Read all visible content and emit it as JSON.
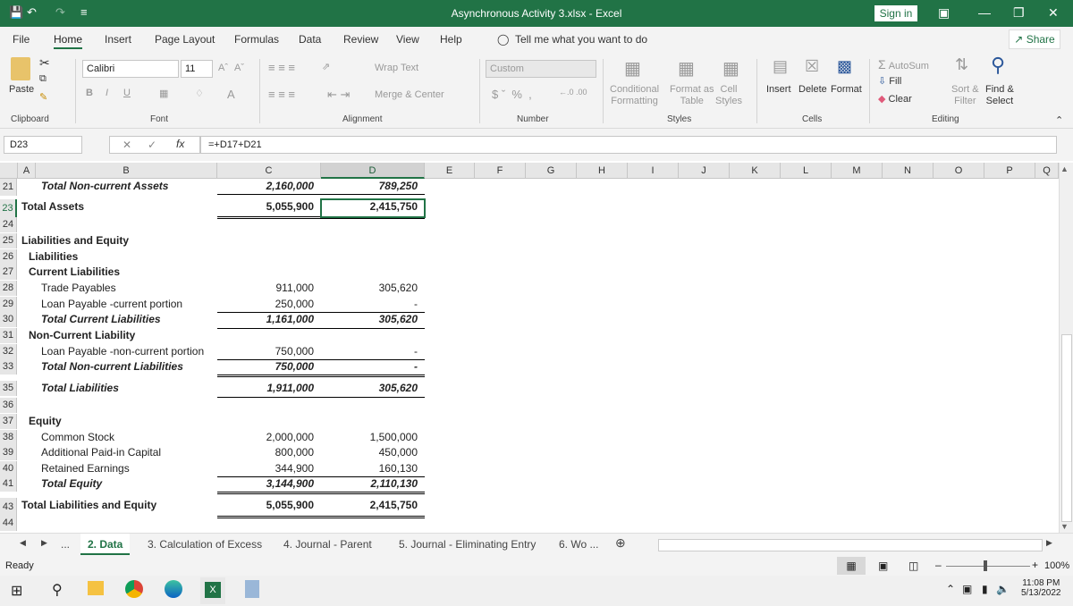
{
  "titlebar": {
    "title": "Asynchronous Activity 3.xlsx  -  Excel",
    "sign_in": "Sign in"
  },
  "menu": {
    "items": [
      "File",
      "Home",
      "Insert",
      "Page Layout",
      "Formulas",
      "Data",
      "Review",
      "View",
      "Help"
    ],
    "tell_me": "Tell me what you want to do",
    "share": "Share"
  },
  "ribbon": {
    "paste": "Paste",
    "font_name": "Calibri",
    "font_size": "11",
    "wrap_text": "Wrap Text",
    "merge_center": "Merge & Center",
    "number_format": "Custom",
    "conditional_formatting": [
      "Conditional",
      "Formatting"
    ],
    "format_as_table": [
      "Format as",
      "Table"
    ],
    "cell_styles": [
      "Cell",
      "Styles"
    ],
    "insert": "Insert",
    "delete": "Delete",
    "format": "Format",
    "autosum": "AutoSum",
    "fill": "Fill",
    "clear": "Clear",
    "sort_filter": [
      "Sort &",
      "Filter"
    ],
    "find_select": [
      "Find &",
      "Select"
    ],
    "groups": [
      "Clipboard",
      "Font",
      "Alignment",
      "Number",
      "Styles",
      "Cells",
      "Editing"
    ]
  },
  "formula_bar": {
    "name_box": "D23",
    "formula": "=+D17+D21"
  },
  "columns": [
    "A",
    "B",
    "C",
    "D",
    "E",
    "F",
    "G",
    "H",
    "I",
    "J",
    "K",
    "L",
    "M",
    "N",
    "O",
    "P",
    "Q"
  ],
  "sheet": {
    "rows": [
      {
        "n": "21",
        "label": "Total Non-current Assets",
        "style": "bi",
        "indent": 2,
        "c": "2,160,000",
        "d": "789,250"
      },
      {
        "n": "23",
        "label": "Total Assets",
        "style": "b",
        "indent": 0,
        "c": "5,055,900",
        "d": "2,415,750"
      },
      {
        "n": "24",
        "label": "",
        "style": "",
        "indent": 0,
        "c": "",
        "d": ""
      },
      {
        "n": "25",
        "label": "Liabilities and Equity",
        "style": "b",
        "indent": 0,
        "c": "",
        "d": ""
      },
      {
        "n": "26",
        "label": "Liabilities",
        "style": "b",
        "indent": 1,
        "c": "",
        "d": ""
      },
      {
        "n": "27",
        "label": "Current Liabilities",
        "style": "b",
        "indent": 1,
        "c": "",
        "d": ""
      },
      {
        "n": "28",
        "label": "Trade Payables",
        "style": "",
        "indent": 2,
        "c": "911,000",
        "d": "305,620"
      },
      {
        "n": "29",
        "label": "Loan Payable -current portion",
        "style": "",
        "indent": 2,
        "c": "250,000",
        "d": "-"
      },
      {
        "n": "30",
        "label": "Total Current Liabilities",
        "style": "bi",
        "indent": 2,
        "c": "1,161,000",
        "d": "305,620"
      },
      {
        "n": "31",
        "label": "Non-Current Liability",
        "style": "b",
        "indent": 1,
        "c": "",
        "d": ""
      },
      {
        "n": "32",
        "label": "Loan Payable -non-current portion",
        "style": "",
        "indent": 2,
        "c": "750,000",
        "d": "-"
      },
      {
        "n": "33",
        "label": "Total Non-current Liabilities",
        "style": "bi",
        "indent": 2,
        "c": "750,000",
        "d": "-"
      },
      {
        "n": "35",
        "label": "Total Liabilities",
        "style": "bi",
        "indent": 2,
        "c": "1,911,000",
        "d": "305,620"
      },
      {
        "n": "36",
        "label": "",
        "style": "",
        "indent": 0,
        "c": "",
        "d": ""
      },
      {
        "n": "37",
        "label": "Equity",
        "style": "b",
        "indent": 1,
        "c": "",
        "d": ""
      },
      {
        "n": "38",
        "label": "Common Stock",
        "style": "",
        "indent": 2,
        "c": "2,000,000",
        "d": "1,500,000"
      },
      {
        "n": "39",
        "label": "Additional Paid-in Capital",
        "style": "",
        "indent": 2,
        "c": "800,000",
        "d": "450,000"
      },
      {
        "n": "40",
        "label": "Retained Earnings",
        "style": "",
        "indent": 2,
        "c": "344,900",
        "d": "160,130"
      },
      {
        "n": "41",
        "label": "Total Equity",
        "style": "bi",
        "indent": 2,
        "c": "3,144,900",
        "d": "2,110,130"
      },
      {
        "n": "43",
        "label": "Total Liabilities and Equity",
        "style": "b",
        "indent": 0,
        "c": "5,055,900",
        "d": "2,415,750"
      },
      {
        "n": "44",
        "label": "",
        "style": "",
        "indent": 0,
        "c": "",
        "d": ""
      }
    ]
  },
  "tabs": {
    "items": [
      "2. Data",
      "3. Calculation of Excess",
      "4. Journal - Parent",
      "5. Journal - Eliminating Entry",
      "6. Wo ..."
    ],
    "active": "2. Data"
  },
  "status": {
    "text": "Ready",
    "zoom": "100%"
  },
  "taskbar": {
    "time": "11:08 PM",
    "date": "5/13/2022"
  }
}
